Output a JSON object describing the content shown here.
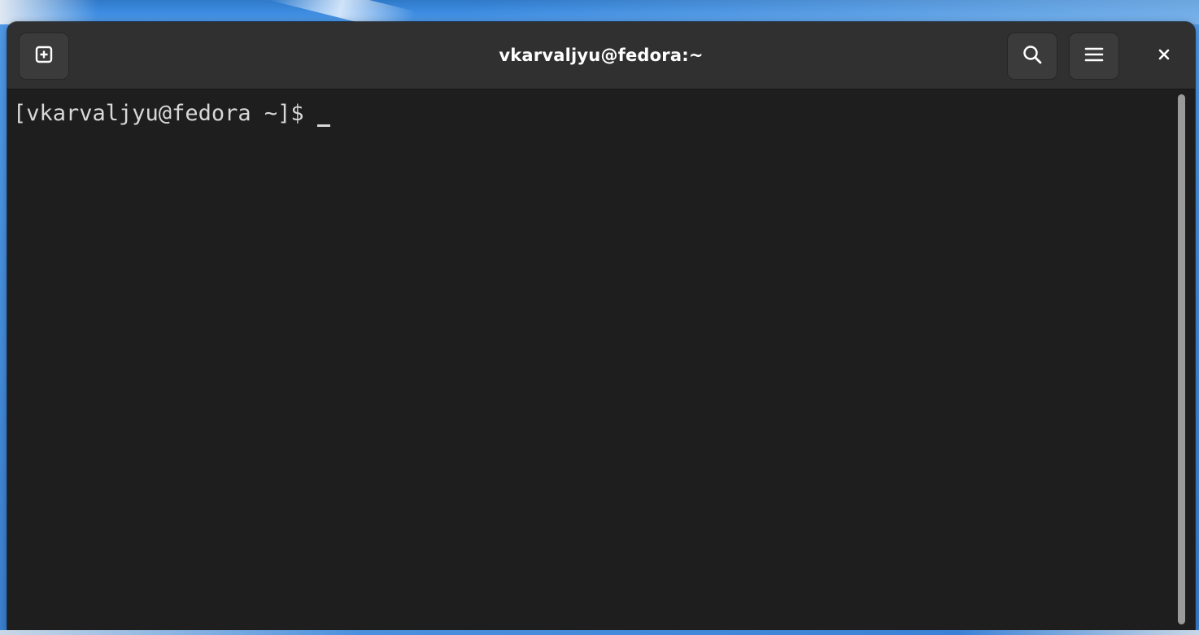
{
  "window": {
    "title": "vkarvaljyu@fedora:~"
  },
  "headerbar": {
    "new_tab_icon": "new-tab-plus-icon",
    "search_icon": "search-icon",
    "menu_icon": "hamburger-menu-icon",
    "close_icon": "close-icon"
  },
  "terminal": {
    "prompt": "[vkarvaljyu@fedora ~]$ ",
    "cursor_style": "underline"
  },
  "colors": {
    "headerbar_bg": "#303030",
    "terminal_bg": "#1e1e1e",
    "terminal_fg": "#d8d8d8",
    "title_fg": "#ffffff",
    "desktop_accent": "#3c8be0"
  }
}
